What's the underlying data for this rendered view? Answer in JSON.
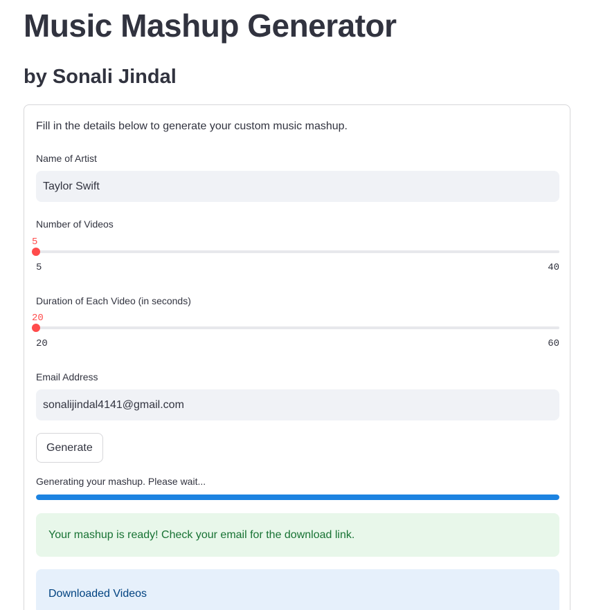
{
  "page": {
    "title": "Music Mashup Generator",
    "subtitle": "by Sonali Jindal"
  },
  "form": {
    "intro": "Fill in the details below to generate your custom music mashup.",
    "artist": {
      "label": "Name of Artist",
      "value": "Taylor Swift"
    },
    "videos": {
      "label": "Number of Videos",
      "value": "5",
      "min": "5",
      "max": "40"
    },
    "duration": {
      "label": "Duration of Each Video (in seconds)",
      "value": "20",
      "min": "20",
      "max": "60"
    },
    "email": {
      "label": "Email Address",
      "value": "sonalijindal4141@gmail.com"
    },
    "generate_label": "Generate",
    "progress": {
      "text": "Generating your mashup. Please wait...",
      "percent": 100
    },
    "success_message": "Your mashup is ready! Check your email for the download link.",
    "info_message": "Downloaded Videos"
  },
  "colors": {
    "accent": "#ff4b4b",
    "progress": "#1c83e1",
    "success_bg": "#e8f7ea",
    "success_text": "#177233",
    "info_bg": "#e6f0fb",
    "info_text": "#004280"
  }
}
